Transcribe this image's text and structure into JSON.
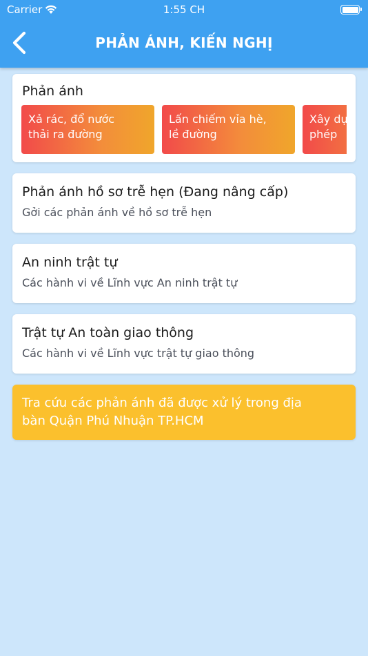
{
  "status_bar": {
    "carrier": "Carrier",
    "time": "1:55 CH"
  },
  "header": {
    "title": "PHẢN ÁNH, KIẾN NGHỊ",
    "back_icon": "chevron-left-icon"
  },
  "categories": {
    "title": "Phản ánh",
    "chips": [
      {
        "line1": "Xả rác, đổ nước",
        "line2": "thải ra đường"
      },
      {
        "line1": "Lấn chiếm vỉa hè,",
        "line2": "lề đường"
      },
      {
        "line1": "Xây dựng không",
        "line2": "phép"
      }
    ]
  },
  "items": [
    {
      "title": "Phản ánh hồ sơ trễ hẹn (Đang nâng cấp)",
      "subtitle": "Gởi các phản ánh về hồ sơ trễ hẹn"
    },
    {
      "title": "An ninh trật tự",
      "subtitle": "Các hành vi về Lĩnh vực An ninh trật tự"
    },
    {
      "title": "Trật tự An toàn giao thông",
      "subtitle": "Các hành vi về Lĩnh vực trật tự giao thông"
    }
  ],
  "notice": {
    "line1": "Tra cứu các phản ánh đã được xử lý trong địa",
    "line2": "bàn Quận Phú Nhuận TP.HCM"
  },
  "colors": {
    "header": "#3ea1f1",
    "background": "#cde6fb",
    "chip_gradient_start": "#f24a4a",
    "chip_gradient_end": "#f0a62b",
    "notice": "#fbc02d"
  }
}
